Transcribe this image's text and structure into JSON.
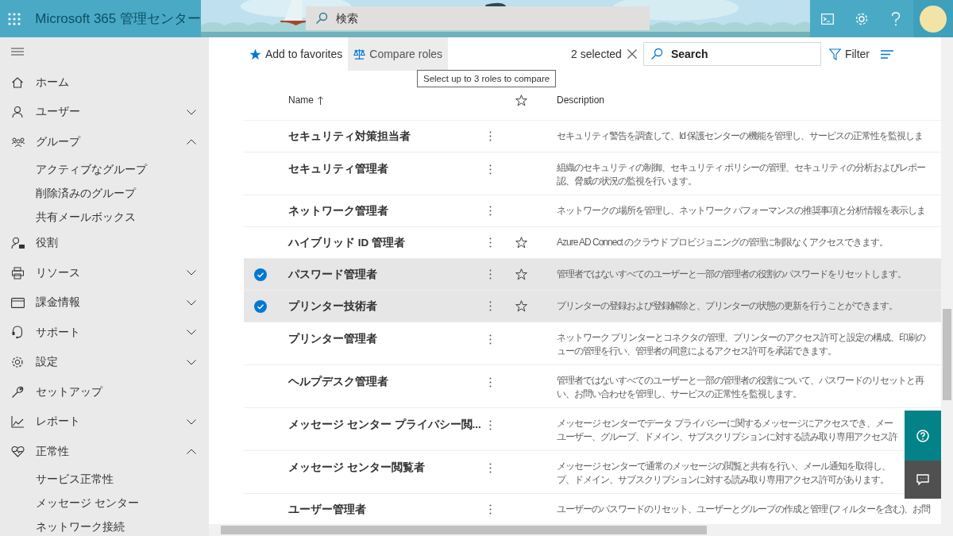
{
  "header": {
    "title": "Microsoft 365 管理センター",
    "search": {
      "placeholder": "検索"
    }
  },
  "sidebar": {
    "items": [
      {
        "label": "ホーム"
      },
      {
        "label": "ユーザー",
        "expanded": false
      },
      {
        "label": "グループ",
        "expanded": true,
        "children": [
          {
            "label": "アクティブなグループ"
          },
          {
            "label": "削除済みのグループ"
          },
          {
            "label": "共有メールボックス"
          }
        ]
      },
      {
        "label": "役割"
      },
      {
        "label": "リソース",
        "expanded": false
      },
      {
        "label": "課金情報",
        "expanded": false
      },
      {
        "label": "サポート",
        "expanded": false
      },
      {
        "label": "設定",
        "expanded": false
      },
      {
        "label": "セットアップ"
      },
      {
        "label": "レポート",
        "expanded": false
      },
      {
        "label": "正常性",
        "expanded": true,
        "children": [
          {
            "label": "サービス正常性"
          },
          {
            "label": "メッセージ センター"
          },
          {
            "label": "ネットワーク接続"
          }
        ]
      }
    ]
  },
  "toolbar": {
    "add_to_favorites": "Add to favorites",
    "compare_roles": {
      "label": "Compare roles",
      "hovered": true
    },
    "tooltip": "Select up to 3 roles to compare",
    "selected_count": "2 selected",
    "search": {
      "placeholder": "Search"
    },
    "filter": "Filter"
  },
  "table": {
    "columns": [
      "Name",
      "Description"
    ],
    "rows": [
      {
        "name": "セキュリティ対策担当者",
        "selected": false,
        "show_star": false,
        "description_lines": [
          "セキュリティ警告を調査して、Id 保護センターの機能を管理し、サービスの正常性を監視しま"
        ]
      },
      {
        "name": "セキュリティ管理者",
        "selected": false,
        "show_star": false,
        "description_lines": [
          "組織のセキュリティの制御、セキュリティ ポリシーの管理、セキュリティの分析およびレポー",
          "認、脅威の状況の監視を行います。"
        ]
      },
      {
        "name": "ネットワーク管理者",
        "selected": false,
        "show_star": false,
        "description_lines": [
          "ネットワークの場所を管理し、ネットワーク パフォーマンスの推奨事項と分析情報を表示しま"
        ]
      },
      {
        "name": "ハイブリッド ID 管理者",
        "selected": false,
        "show_star": true,
        "description_lines": [
          "Azure AD Connect のクラウド プロビジョニングの管理に制限なくアクセスできます。"
        ]
      },
      {
        "name": "パスワード管理者",
        "selected": true,
        "show_star": true,
        "description_lines": [
          "管理者ではないすべてのユーザーと一部の管理者の役割のパスワードをリセットします。"
        ]
      },
      {
        "name": "プリンター技術者",
        "selected": true,
        "show_star": true,
        "description_lines": [
          "プリンターの登録および登録解除と、プリンターの状態の更新を行うことができます。"
        ]
      },
      {
        "name": "プリンター管理者",
        "selected": false,
        "show_star": false,
        "description_lines": [
          "ネットワーク プリンターとコネクタの管理、プリンターのアクセス許可と設定の構成、印刷の",
          "ューの管理を行い、管理者の同意によるアクセス許可を承諾できます。"
        ]
      },
      {
        "name": "ヘルプデスク管理者",
        "selected": false,
        "show_star": false,
        "description_lines": [
          "管理者ではないすべてのユーザーと一部の管理者の役割について、パスワードのリセットと再",
          "い、お問い合わせを管理し、サービスの正常性を監視します。"
        ]
      },
      {
        "name": "メッセージ センター プライバシー閲...",
        "selected": false,
        "show_star": false,
        "description_lines": [
          "メッセージ センターでデータ プライバシーに関するメッセージにアクセスでき、メー",
          "ユーザー、グループ、ドメイン、サブスクリプションに対する読み取り専用アクセス許"
        ]
      },
      {
        "name": "メッセージ センター閲覧者",
        "selected": false,
        "show_star": false,
        "description_lines": [
          "メッセージ センターで通常のメッセージの閲覧と共有を行い、メール通知を取得し、",
          "プ、ドメイン、サブスクリプションに対する読み取り専用アクセス許可があります。"
        ]
      },
      {
        "name": "ユーザー管理者",
        "selected": false,
        "show_star": false,
        "description_lines": [
          "ユーザーのパスワードのリセット、ユーザーとグループの作成と管理 (フィルターを含む)、お問"
        ]
      }
    ]
  }
}
